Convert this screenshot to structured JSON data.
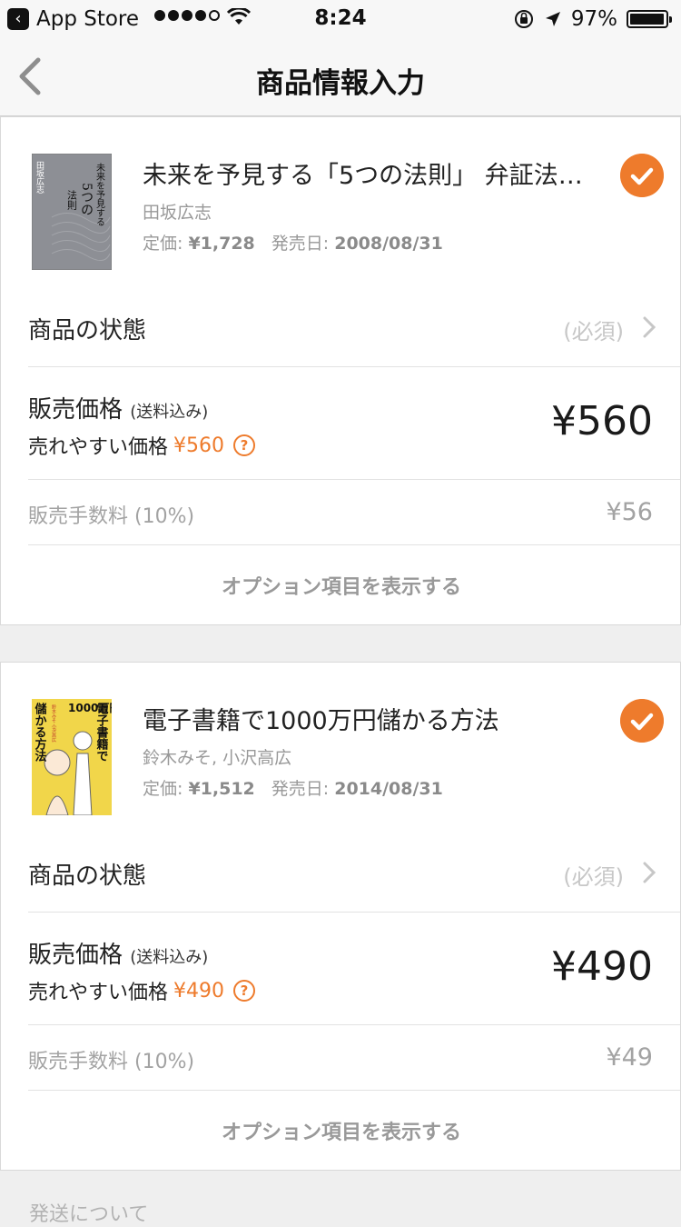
{
  "status": {
    "back_app": "App Store",
    "time": "8:24",
    "battery": "97%",
    "battery_level": 0.97
  },
  "nav": {
    "title": "商品情報入力"
  },
  "items": [
    {
      "title": "未来を予見する「5つの法則」 弁証法…",
      "author": "田坂広志",
      "list_price_label": "定価:",
      "list_price": "¥1,728",
      "release_label": "発売日:",
      "release_date": "2008/08/31",
      "condition_label": "商品の状態",
      "condition_placeholder": "(必須)",
      "price_label": "販売価格",
      "price_note": "(送料込み)",
      "hint_label": "売れやすい価格",
      "hint_price": "¥560",
      "help_icon": "?",
      "price": "¥560",
      "fee_label": "販売手数料 (10%)",
      "fee": "¥56",
      "option_label": "オプション項目を表示する"
    },
    {
      "title": "電子書籍で1000万円儲かる方法",
      "author": "鈴木みそ, 小沢高広",
      "list_price_label": "定価:",
      "list_price": "¥1,512",
      "release_label": "発売日:",
      "release_date": "2014/08/31",
      "condition_label": "商品の状態",
      "condition_placeholder": "(必須)",
      "price_label": "販売価格",
      "price_note": "(送料込み)",
      "hint_label": "売れやすい価格",
      "hint_price": "¥490",
      "help_icon": "?",
      "price": "¥490",
      "fee_label": "販売手数料 (10%)",
      "fee": "¥49",
      "option_label": "オプション項目を表示する"
    }
  ],
  "covers": {
    "book1": {
      "lines": [
        "未来を予見する",
        "5つの",
        "法則"
      ],
      "author": "田坂広志"
    },
    "book2": {
      "lines": [
        "電子書籍で",
        "1000万円",
        "儲かる方法"
      ],
      "authors": "鈴木みそ 小沢高広"
    }
  },
  "next_section": "発送について",
  "colors": {
    "accent": "#ee7b2c"
  }
}
